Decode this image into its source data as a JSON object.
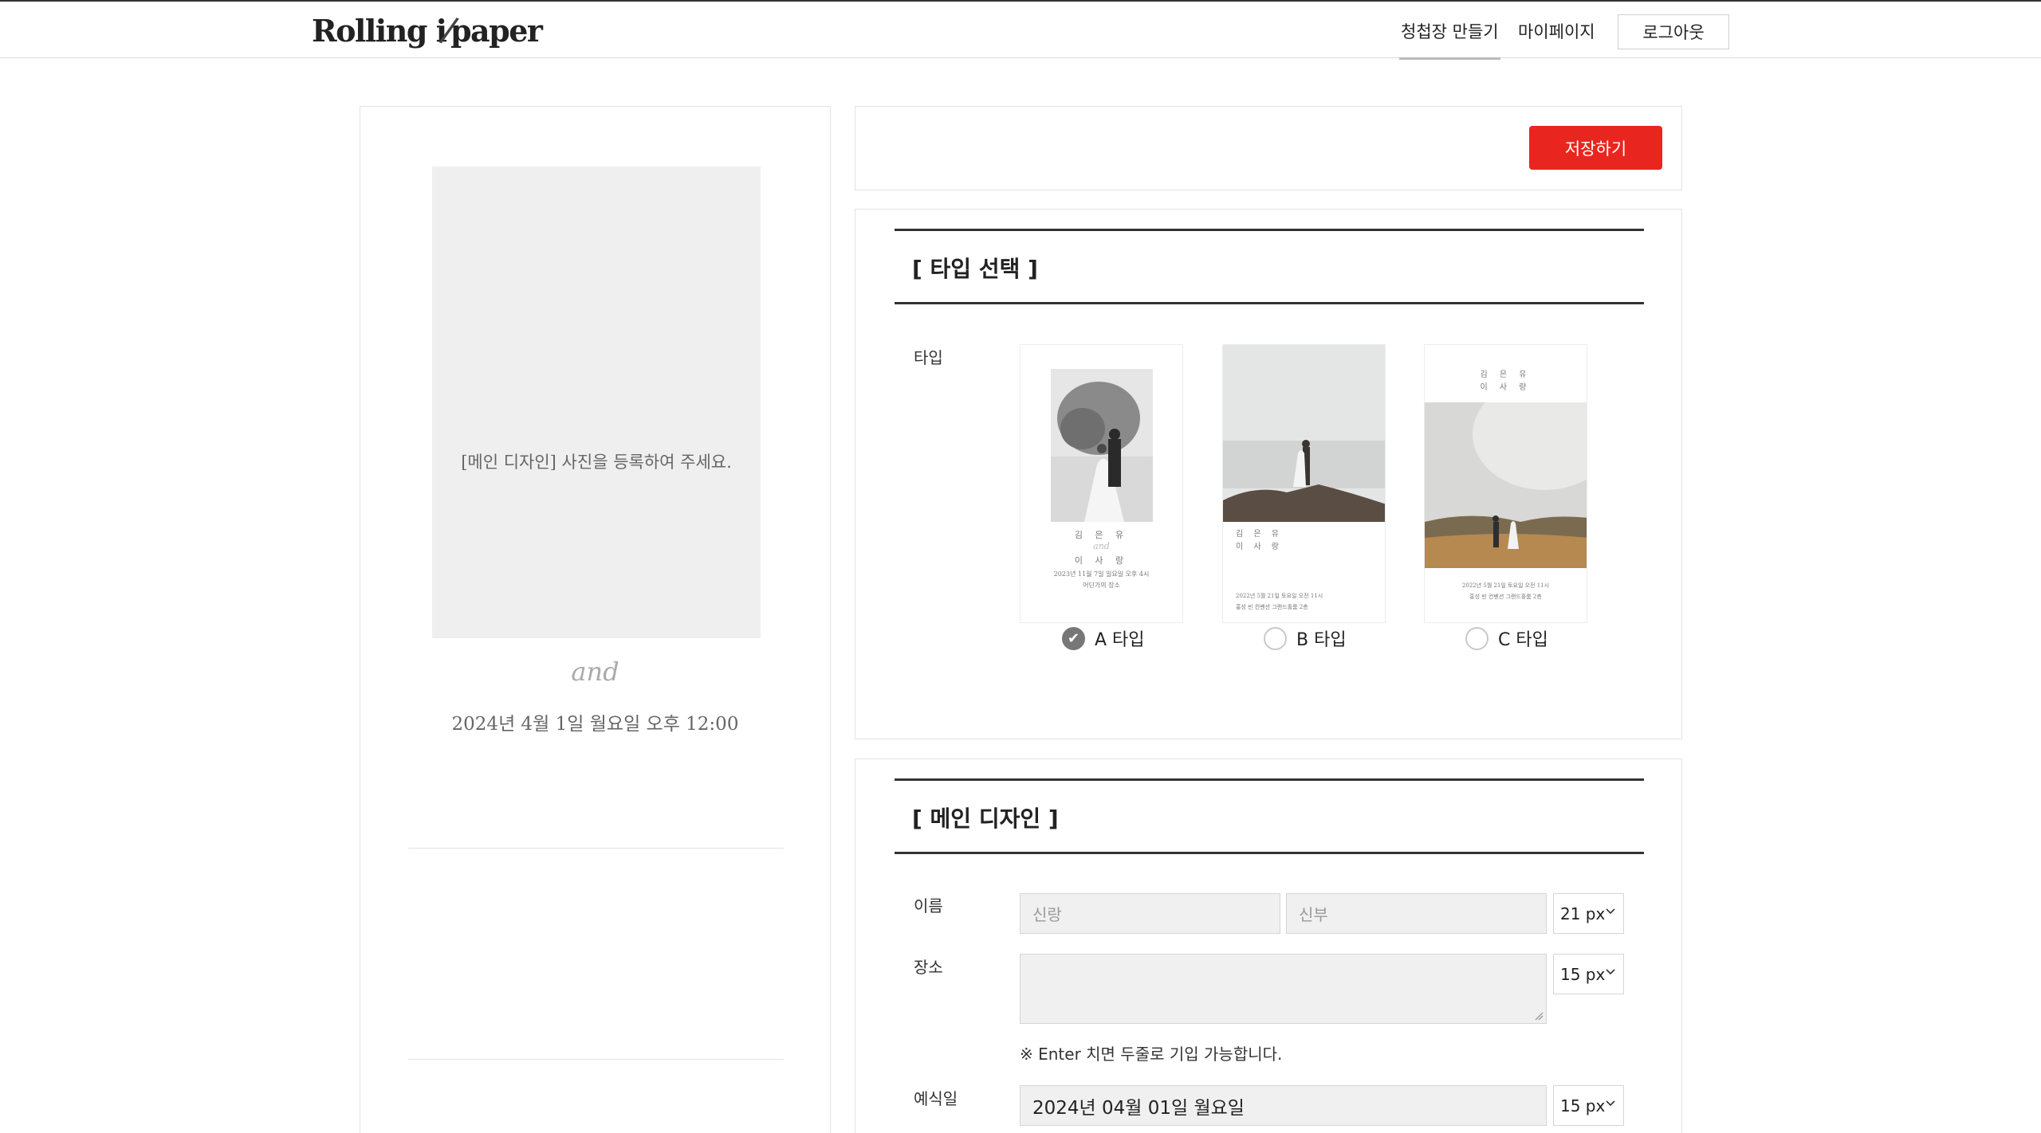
{
  "header": {
    "logo": "Rolling in paper",
    "logo_parts": {
      "left": "Rolling i",
      "right": "paper"
    },
    "nav": [
      {
        "label": "청첩장 만들기"
      },
      {
        "label": "마이페이지"
      }
    ],
    "logout_label": "로그아웃"
  },
  "preview": {
    "photo_message": "[메인 디자인] 사진을 등록하여 주세요.",
    "and_text": "and",
    "date_text": "2024년 4월 1일 월요일 오후 12:00"
  },
  "toolbar": {
    "save_label": "저장하기"
  },
  "type_section": {
    "title": "[ 타입 선택 ]",
    "label": "타입",
    "options": [
      {
        "label": "A 타입",
        "checked": true,
        "names": [
          "김 은 유",
          "and",
          "이 사 랑"
        ],
        "info": [
          "2023년 11월 7일 일요일 오후 4시",
          "어딘가의 장소"
        ]
      },
      {
        "label": "B 타입",
        "checked": false,
        "names": [
          "김 은 유",
          "이 사 랑"
        ],
        "info": [
          "2022년 5월 21일 토요일 오전 11시",
          "홍성 빈 컨벤션 그랜드홀룸 2층"
        ]
      },
      {
        "label": "C 타입",
        "checked": false,
        "names": [
          "김 은 유",
          "이 사 랑"
        ],
        "info": [
          "2022년 5월 21일 토요일 오전 11시",
          "홍성 빈 컨벤션 그랜드홀룸 2층"
        ]
      }
    ]
  },
  "main_design": {
    "title": "[ 메인 디자인 ]",
    "name_label": "이름",
    "groom_placeholder": "신랑",
    "bride_placeholder": "신부",
    "name_font_size": "21 px",
    "place_label": "장소",
    "place_font_size": "15 px",
    "place_note": "※ Enter 치면 두줄로 기입 가능합니다.",
    "date_label": "예식일",
    "date_value": "2024년 04월 01일 월요일",
    "date_font_size": "15 px"
  },
  "colors": {
    "accent": "#e8261f",
    "panel_bg": "#efefef",
    "border": "#e2e2e2"
  }
}
